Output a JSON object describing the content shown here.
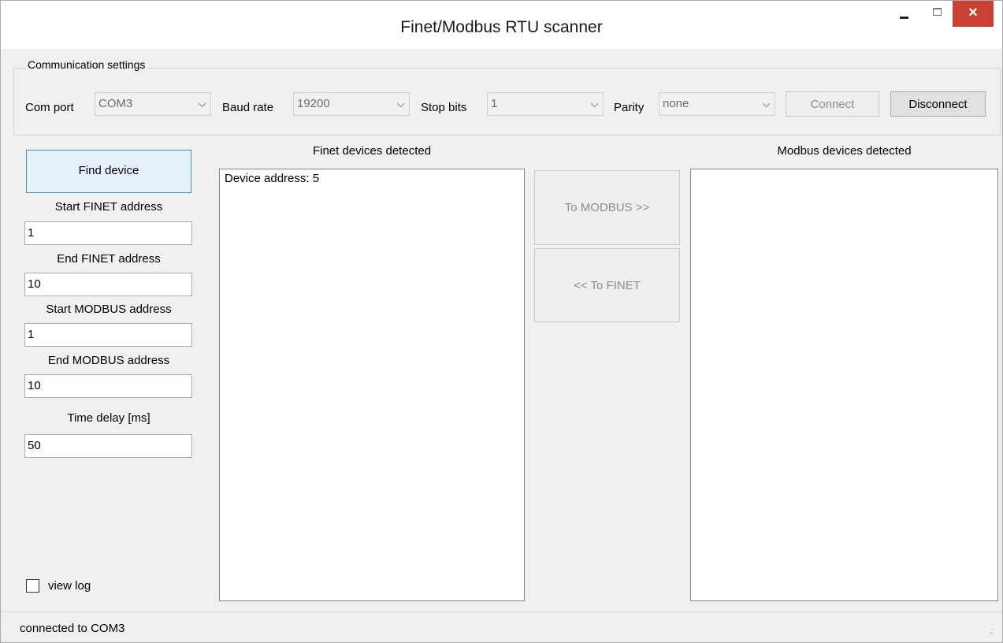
{
  "window": {
    "title": "Finet/Modbus RTU scanner",
    "close_glyph": "×"
  },
  "communication": {
    "legend": "Communication settings",
    "com_port_label": "Com port",
    "com_port_value": "COM3",
    "baud_rate_label": "Baud rate",
    "baud_rate_value": "19200",
    "stop_bits_label": "Stop bits",
    "stop_bits_value": "1",
    "parity_label": "Parity",
    "parity_value": "none",
    "connect_label": "Connect",
    "disconnect_label": "Disconnect"
  },
  "left_panel": {
    "find_device_label": "Find device",
    "start_finet_label": "Start FINET address",
    "start_finet_value": "1",
    "end_finet_label": "End FINET address",
    "end_finet_value": "10",
    "start_modbus_label": "Start MODBUS address",
    "start_modbus_value": "1",
    "end_modbus_label": "End MODBUS address",
    "end_modbus_value": "10",
    "time_delay_label": "Time delay [ms]",
    "time_delay_value": "50",
    "view_log_label": "view log",
    "view_log_checked": false
  },
  "finet": {
    "header": "Finet devices detected",
    "items": [
      "Device address: 5"
    ]
  },
  "transfer": {
    "to_modbus_label": "To MODBUS >>",
    "to_finet_label": "<< To FINET"
  },
  "modbus": {
    "header": "Modbus devices detected",
    "items": []
  },
  "status": {
    "text": "connected to COM3"
  },
  "icons": {
    "combo_arrow": "chevron-down-icon",
    "minimize": "minimize-icon",
    "maximize": "maximize-icon",
    "close": "close-icon",
    "grip": "resize-grip-icon"
  },
  "colors": {
    "close_button": "#c94135",
    "focus_border": "#3c8fd6",
    "window_bg": "#f0f0f0"
  }
}
